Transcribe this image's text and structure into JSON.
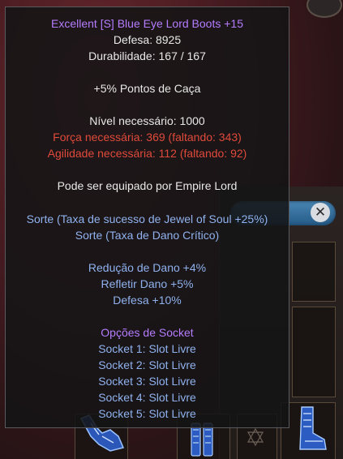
{
  "item": {
    "name": "Excellent [S] Blue Eye Lord Boots +15",
    "defense": "Defesa: 8925",
    "durability": "Durabilidade: 167 / 167",
    "bonus": "+5% Pontos de Caça",
    "level_req": "Nível necessário: 1000",
    "str_req": "Força necessária: 369 (faltando: 343)",
    "agi_req": "Agilidade necessária: 112 (faltando: 92)",
    "equip_by": "Pode ser equipado por Empire Lord",
    "luck_1": "Sorte (Taxa de sucesso de Jewel of Soul +25%)",
    "luck_2": "Sorte (Taxa de Dano Crítico)",
    "exc_1": "Redução de Dano +4%",
    "exc_2": "Refletir Dano +5%",
    "exc_3": "Defesa +10%",
    "socket_title": "Opções de Socket",
    "sockets": [
      "Socket 1: Slot Livre",
      "Socket 2: Slot Livre",
      "Socket 3: Slot Livre",
      "Socket 4: Slot Livre",
      "Socket 5: Slot Livre"
    ]
  },
  "colors": {
    "name": "#b57cff",
    "normal": "#e8e8e8",
    "requirement_unmet": "#e04a3a",
    "option": "#8fb2ee"
  },
  "background": {
    "close_glyph": "✕",
    "icons": [
      "boots-icon",
      "gauntlet-icon",
      "glove-icon",
      "star-icon"
    ]
  }
}
